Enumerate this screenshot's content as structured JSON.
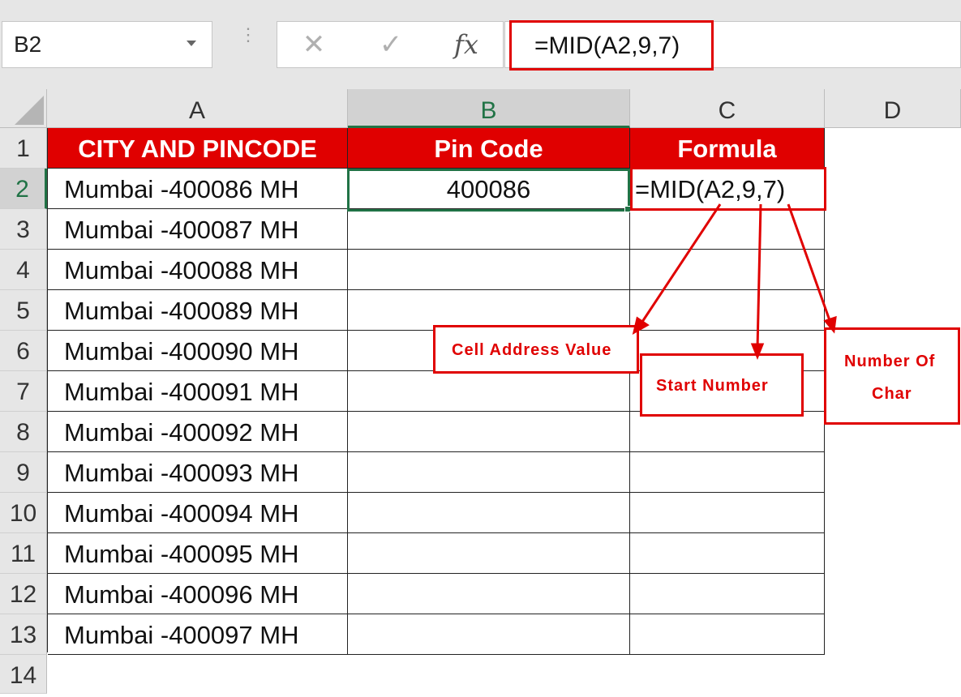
{
  "name_box": {
    "value": "B2"
  },
  "formula_bar": {
    "cancel_icon": "close-icon",
    "enter_icon": "check-icon",
    "fx_label": "fx",
    "formula": "=MID(A2,9,7)"
  },
  "columns": [
    "A",
    "B",
    "C",
    "D"
  ],
  "rows": [
    "1",
    "2",
    "3",
    "4",
    "5",
    "6",
    "7",
    "8",
    "9",
    "10",
    "11",
    "12",
    "13",
    "14"
  ],
  "table": {
    "headers": [
      "CITY AND PINCODE",
      "Pin Code",
      "Formula"
    ],
    "col_a": [
      "Mumbai -400086 MH",
      "Mumbai -400087 MH",
      "Mumbai -400088 MH",
      "Mumbai -400089 MH",
      "Mumbai -400090 MH",
      "Mumbai -400091 MH",
      "Mumbai -400092 MH",
      "Mumbai -400093 MH",
      "Mumbai -400094 MH",
      "Mumbai -400095 MH",
      "Mumbai -400096 MH",
      "Mumbai -400097 MH"
    ],
    "b2": "400086",
    "c2": "=MID(A2,9,7)"
  },
  "annotations": {
    "cell_address": "Cell Address Value",
    "start_number": "Start Number",
    "num_char_line1": "Number Of",
    "num_char_line2": "Char"
  },
  "colors": {
    "header_red": "#e00000",
    "excel_green": "#217346",
    "annotation_red": "#e00000"
  }
}
